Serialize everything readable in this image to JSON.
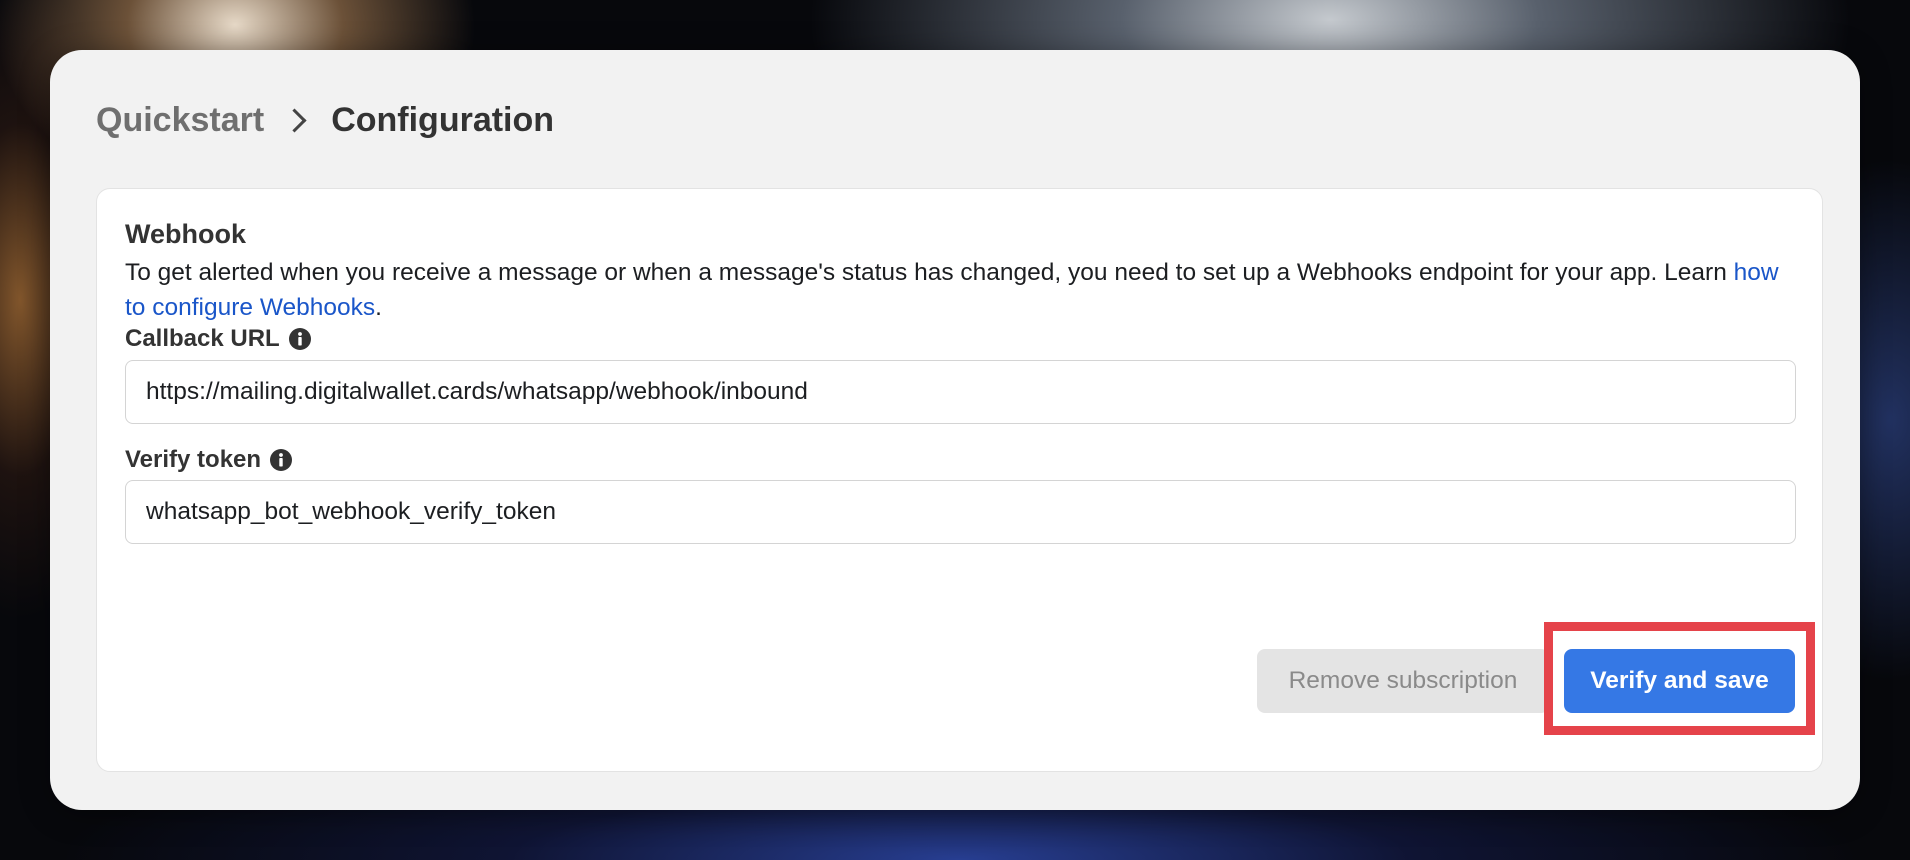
{
  "breadcrumb": {
    "root": "Quickstart",
    "current": "Configuration"
  },
  "webhook": {
    "title": "Webhook",
    "description": "To get alerted when you receive a message or when a message's status has changed, you need to set up a Webhooks endpoint for your app. Learn ",
    "link_text": "how to configure Webhooks",
    "description_end": ".",
    "callback_label": "Callback URL",
    "callback_value": "https://mailing.digitalwallet.cards/whatsapp/webhook/inbound",
    "token_label": "Verify token",
    "token_value": "whatsapp_bot_webhook_verify_token"
  },
  "actions": {
    "remove_label": "Remove subscription",
    "verify_label": "Verify and save"
  },
  "icons": {
    "info": "info-icon",
    "chevron": "chevron-right-icon"
  },
  "colors": {
    "primary": "#3578e5",
    "link": "#1a56c9",
    "highlight": "#e5434a"
  }
}
